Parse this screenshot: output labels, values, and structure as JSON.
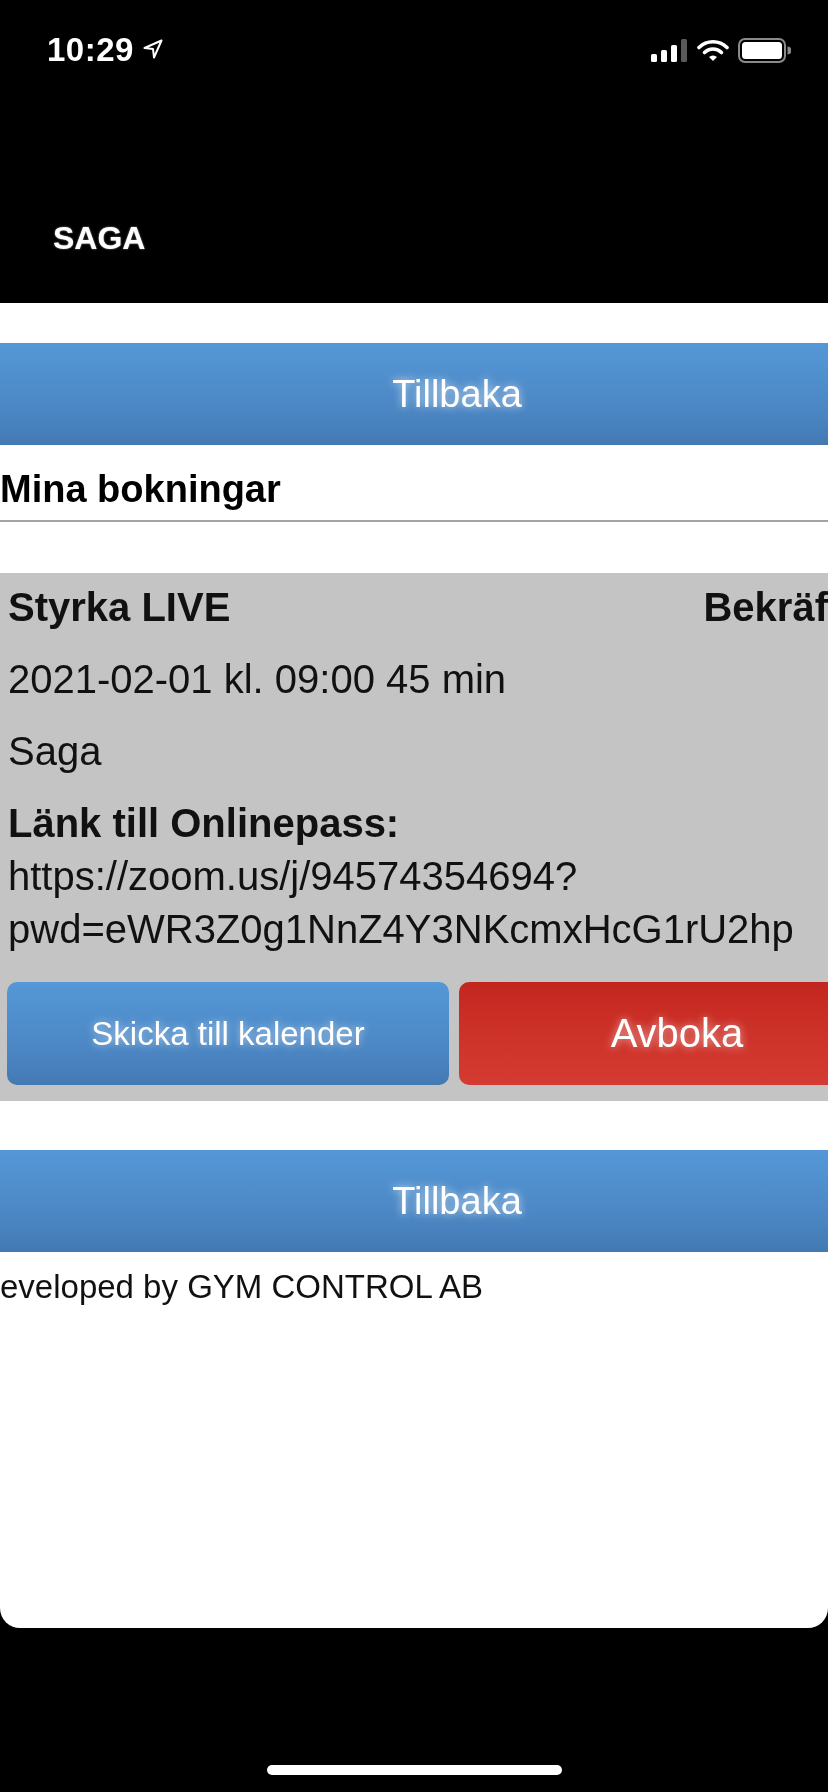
{
  "status_bar": {
    "time": "10:29"
  },
  "header": {
    "title": "SAGA"
  },
  "top_button": {
    "label": "Tillbaka"
  },
  "section": {
    "title": "Mina bokningar"
  },
  "bookings": [
    {
      "title": "Styrka LIVE",
      "status": "Bekräf",
      "when": "2021-02-01 kl. 09:00 45 min",
      "place": "Saga",
      "link_label": "Länk till Onlinepass:",
      "link_lines": [
        "https://zoom.us/j/94574354694?",
        "pwd=eWR3Z0g1NnZ4Y3NKcmxHcG1rU2hp"
      ],
      "buttons": [
        {
          "label": "Skicka till kalender",
          "kind": "primary"
        },
        {
          "label": "Avboka",
          "kind": "danger"
        }
      ]
    }
  ],
  "bottom_button": {
    "label": "Tillbaka"
  },
  "footer": {
    "text": "eveloped by GYM CONTROL AB"
  }
}
